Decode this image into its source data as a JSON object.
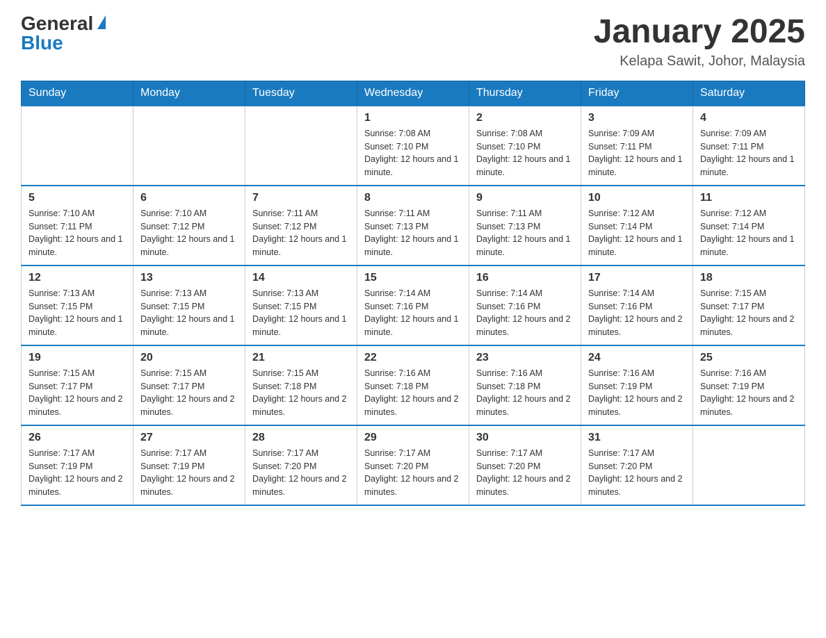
{
  "logo": {
    "general": "General",
    "blue": "Blue"
  },
  "header": {
    "title": "January 2025",
    "location": "Kelapa Sawit, Johor, Malaysia"
  },
  "weekdays": [
    "Sunday",
    "Monday",
    "Tuesday",
    "Wednesday",
    "Thursday",
    "Friday",
    "Saturday"
  ],
  "weeks": [
    [
      {
        "day": null,
        "info": null
      },
      {
        "day": null,
        "info": null
      },
      {
        "day": null,
        "info": null
      },
      {
        "day": "1",
        "info": "Sunrise: 7:08 AM\nSunset: 7:10 PM\nDaylight: 12 hours and 1 minute."
      },
      {
        "day": "2",
        "info": "Sunrise: 7:08 AM\nSunset: 7:10 PM\nDaylight: 12 hours and 1 minute."
      },
      {
        "day": "3",
        "info": "Sunrise: 7:09 AM\nSunset: 7:11 PM\nDaylight: 12 hours and 1 minute."
      },
      {
        "day": "4",
        "info": "Sunrise: 7:09 AM\nSunset: 7:11 PM\nDaylight: 12 hours and 1 minute."
      }
    ],
    [
      {
        "day": "5",
        "info": "Sunrise: 7:10 AM\nSunset: 7:11 PM\nDaylight: 12 hours and 1 minute."
      },
      {
        "day": "6",
        "info": "Sunrise: 7:10 AM\nSunset: 7:12 PM\nDaylight: 12 hours and 1 minute."
      },
      {
        "day": "7",
        "info": "Sunrise: 7:11 AM\nSunset: 7:12 PM\nDaylight: 12 hours and 1 minute."
      },
      {
        "day": "8",
        "info": "Sunrise: 7:11 AM\nSunset: 7:13 PM\nDaylight: 12 hours and 1 minute."
      },
      {
        "day": "9",
        "info": "Sunrise: 7:11 AM\nSunset: 7:13 PM\nDaylight: 12 hours and 1 minute."
      },
      {
        "day": "10",
        "info": "Sunrise: 7:12 AM\nSunset: 7:14 PM\nDaylight: 12 hours and 1 minute."
      },
      {
        "day": "11",
        "info": "Sunrise: 7:12 AM\nSunset: 7:14 PM\nDaylight: 12 hours and 1 minute."
      }
    ],
    [
      {
        "day": "12",
        "info": "Sunrise: 7:13 AM\nSunset: 7:15 PM\nDaylight: 12 hours and 1 minute."
      },
      {
        "day": "13",
        "info": "Sunrise: 7:13 AM\nSunset: 7:15 PM\nDaylight: 12 hours and 1 minute."
      },
      {
        "day": "14",
        "info": "Sunrise: 7:13 AM\nSunset: 7:15 PM\nDaylight: 12 hours and 1 minute."
      },
      {
        "day": "15",
        "info": "Sunrise: 7:14 AM\nSunset: 7:16 PM\nDaylight: 12 hours and 1 minute."
      },
      {
        "day": "16",
        "info": "Sunrise: 7:14 AM\nSunset: 7:16 PM\nDaylight: 12 hours and 2 minutes."
      },
      {
        "day": "17",
        "info": "Sunrise: 7:14 AM\nSunset: 7:16 PM\nDaylight: 12 hours and 2 minutes."
      },
      {
        "day": "18",
        "info": "Sunrise: 7:15 AM\nSunset: 7:17 PM\nDaylight: 12 hours and 2 minutes."
      }
    ],
    [
      {
        "day": "19",
        "info": "Sunrise: 7:15 AM\nSunset: 7:17 PM\nDaylight: 12 hours and 2 minutes."
      },
      {
        "day": "20",
        "info": "Sunrise: 7:15 AM\nSunset: 7:17 PM\nDaylight: 12 hours and 2 minutes."
      },
      {
        "day": "21",
        "info": "Sunrise: 7:15 AM\nSunset: 7:18 PM\nDaylight: 12 hours and 2 minutes."
      },
      {
        "day": "22",
        "info": "Sunrise: 7:16 AM\nSunset: 7:18 PM\nDaylight: 12 hours and 2 minutes."
      },
      {
        "day": "23",
        "info": "Sunrise: 7:16 AM\nSunset: 7:18 PM\nDaylight: 12 hours and 2 minutes."
      },
      {
        "day": "24",
        "info": "Sunrise: 7:16 AM\nSunset: 7:19 PM\nDaylight: 12 hours and 2 minutes."
      },
      {
        "day": "25",
        "info": "Sunrise: 7:16 AM\nSunset: 7:19 PM\nDaylight: 12 hours and 2 minutes."
      }
    ],
    [
      {
        "day": "26",
        "info": "Sunrise: 7:17 AM\nSunset: 7:19 PM\nDaylight: 12 hours and 2 minutes."
      },
      {
        "day": "27",
        "info": "Sunrise: 7:17 AM\nSunset: 7:19 PM\nDaylight: 12 hours and 2 minutes."
      },
      {
        "day": "28",
        "info": "Sunrise: 7:17 AM\nSunset: 7:20 PM\nDaylight: 12 hours and 2 minutes."
      },
      {
        "day": "29",
        "info": "Sunrise: 7:17 AM\nSunset: 7:20 PM\nDaylight: 12 hours and 2 minutes."
      },
      {
        "day": "30",
        "info": "Sunrise: 7:17 AM\nSunset: 7:20 PM\nDaylight: 12 hours and 2 minutes."
      },
      {
        "day": "31",
        "info": "Sunrise: 7:17 AM\nSunset: 7:20 PM\nDaylight: 12 hours and 2 minutes."
      },
      {
        "day": null,
        "info": null
      }
    ]
  ]
}
